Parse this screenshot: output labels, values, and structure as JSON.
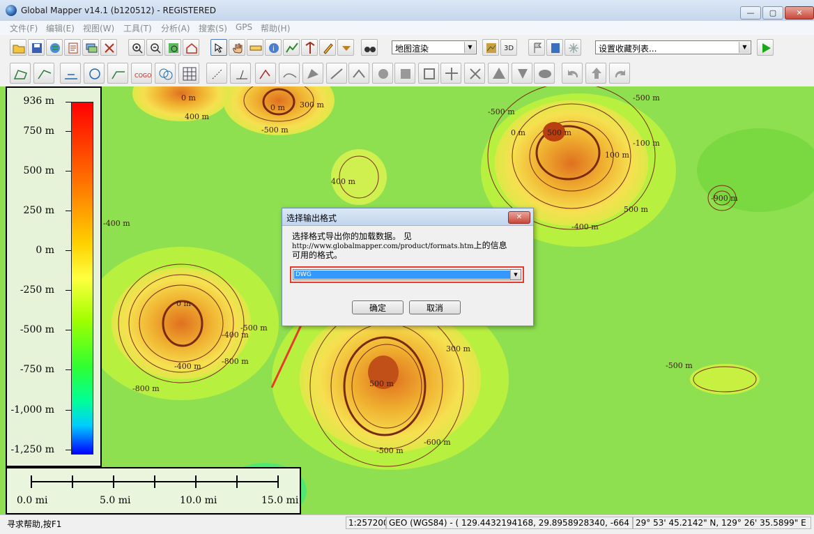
{
  "window": {
    "title": "Global Mapper v14.1 (b120512) - REGISTERED",
    "minimize": "—",
    "maximize": "▢",
    "close": "✕"
  },
  "menu": [
    "文件(F)",
    "编辑(E)",
    "视图(W)",
    "工具(T)",
    "分析(A)",
    "搜索(S)",
    "GPS",
    "帮助(H)"
  ],
  "toolbar": {
    "render_mode": "地图渲染",
    "favorites": "设置收藏列表..."
  },
  "legend": {
    "labels": [
      "936 m",
      "750 m",
      "500 m",
      "250 m",
      "0 m",
      "-250 m",
      "-500 m",
      "-750 m",
      "-1,000 m",
      "-1,250 m"
    ]
  },
  "scale_bar": {
    "labels": [
      "0.0 mi",
      "5.0 mi",
      "10.0 mi",
      "15.0 mi"
    ]
  },
  "contour_labels": [
    "0 m",
    "400 m",
    "0 m",
    "-500 m",
    "300 m",
    "-500 m",
    "0 m",
    "500 m",
    "-100 m",
    "100 m",
    "-400 m",
    "400 m",
    "-400 m",
    "500 m",
    "-900 m",
    "-500 m",
    "-400 m",
    "0 m",
    "-400 m",
    "-800 m",
    "-800 m",
    "300 m",
    "500 m",
    "-500 m",
    "-600 m",
    "-500 m",
    "-500 m"
  ],
  "dialog": {
    "title": "选择输出格式",
    "close": "✕",
    "line1": "选择格式导出你的加载数据。 见",
    "line2_url": "http://www.globalmapper.com/product/formats.htm",
    "line2_rest": "上的信息",
    "line3": "可用的格式。",
    "selected_format": "DWG",
    "ok": "确定",
    "cancel": "取消"
  },
  "status": {
    "help": "寻求帮助,按F1",
    "scale": "1:257200",
    "projection": "GEO (WGS84) - ( 129.4432194168, 29.8958928340, -664 m )",
    "coords": "29° 53' 45.2142\" N, 129° 26' 35.5899\" E"
  },
  "colors": {
    "dialog_highlight": "#e83a2a",
    "selection": "#3399ff",
    "contour": "#7a2a10",
    "play": "#1aa81a"
  }
}
